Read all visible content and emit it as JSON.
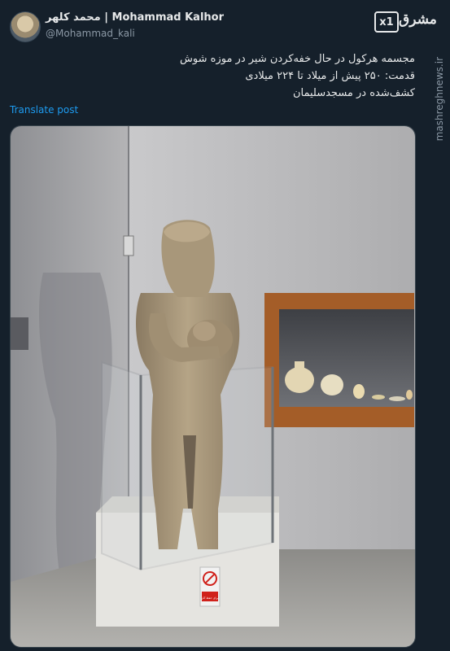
{
  "author": {
    "display_name": "محمد کلهر | Mohammad Kalhor",
    "handle": "@Mohammad_kali"
  },
  "branding": {
    "logo_box": "x1",
    "logo_text": "مشرق",
    "site_url": "mashreghnews.ir"
  },
  "tweet": {
    "lines": [
      "مجسمه هرکول در حال خفه‌کردن شیر در موزه شوش",
      "قدمت: ۲۵۰ پیش از میلاد تا ۲۲۴ میلادی",
      "کشف‌شده در مسجدسلیمان"
    ],
    "translate_label": "Translate post"
  },
  "photo": {
    "sign_text": "برای حفظ آثار"
  }
}
